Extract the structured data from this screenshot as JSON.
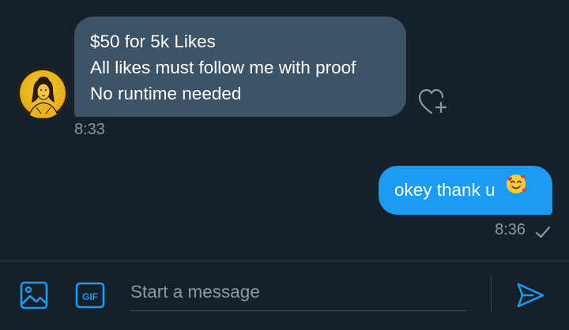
{
  "conversation": {
    "incoming": {
      "lines": [
        "$50 for 5k Likes",
        "All likes must follow me with proof",
        "No runtime needed"
      ],
      "time": "8:33"
    },
    "outgoing": {
      "text": "okey thank u",
      "emoji": "smiling-face-with-hearts",
      "time": "8:36",
      "status": "sent-check-icon"
    }
  },
  "composer": {
    "placeholder": "Start a message",
    "gif_label": "GIF",
    "icons": {
      "image": "image-icon",
      "gif": "gif-icon",
      "send": "send-icon",
      "react": "heart-add-icon"
    }
  },
  "colors": {
    "background": "#15202b",
    "incoming_bubble": "#3d5466",
    "outgoing_bubble": "#1d9bf0",
    "muted_text": "#8899a6",
    "accent": "#1d9bf0"
  }
}
